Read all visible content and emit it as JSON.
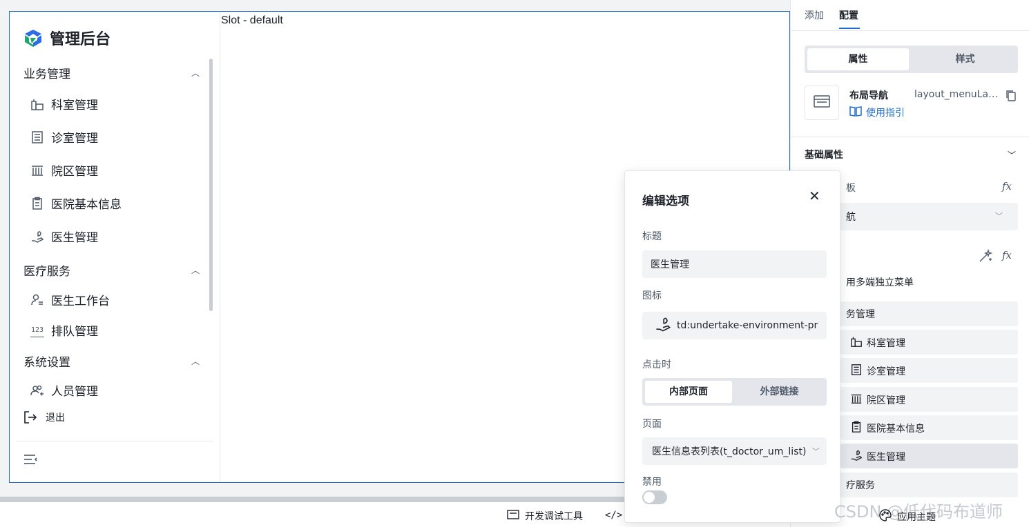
{
  "menu": {
    "logo_title": "管理后台",
    "groups": [
      {
        "label": "业务管理"
      },
      {
        "label": "医疗服务"
      },
      {
        "label": "系统设置"
      }
    ],
    "items": [
      {
        "label": "科室管理",
        "icon": "building-icon"
      },
      {
        "label": "诊室管理",
        "icon": "calculator-icon"
      },
      {
        "label": "院区管理",
        "icon": "institution-icon"
      },
      {
        "label": "医院基本信息",
        "icon": "clipboard-icon"
      },
      {
        "label": "医生管理",
        "icon": "hand-care-icon"
      },
      {
        "label": "医生工作台",
        "icon": "user-list-icon"
      },
      {
        "label": "排队管理",
        "icon": "number-123-icon"
      },
      {
        "label": "人员管理",
        "icon": "users-add-icon"
      }
    ],
    "logout_label": "退出"
  },
  "canvas": {
    "slot_label": "Slot - default"
  },
  "bottom_bar": {
    "debug_label": "开发调试工具",
    "theme_label": "应用主题"
  },
  "right_panel": {
    "tabs": [
      "添加",
      "配置"
    ],
    "segments": [
      "属性",
      "样式"
    ],
    "component_name": "布局导航",
    "component_id": "layout_menuLayout",
    "guide_label": "使用指引",
    "section_title": "基础属性",
    "partial_label_1": "板",
    "partial_select_value": "航",
    "partial_text": "用多端独立菜单",
    "tree": [
      {
        "label": "务管理"
      },
      {
        "label": "科室管理"
      },
      {
        "label": "诊室管理"
      },
      {
        "label": "院区管理"
      },
      {
        "label": "医院基本信息"
      },
      {
        "label": "医生管理"
      },
      {
        "label": "疗服务"
      }
    ]
  },
  "popover": {
    "title": "编辑选项",
    "title_label": "标题",
    "title_value": "医生管理",
    "icon_label": "图标",
    "icon_value": "td:undertake-environment-pr",
    "click_label": "点击时",
    "click_options": [
      "内部页面",
      "外部链接"
    ],
    "page_label": "页面",
    "page_value": "医生信息表列表(t_doctor_um_list)",
    "disabled_label": "禁用",
    "disabled": false
  },
  "watermark": "CSDN @低代码布道师",
  "colors": {
    "accent": "#1f6fd1",
    "logo_green": "#1aa86b",
    "logo_blue": "#2b6de4"
  }
}
